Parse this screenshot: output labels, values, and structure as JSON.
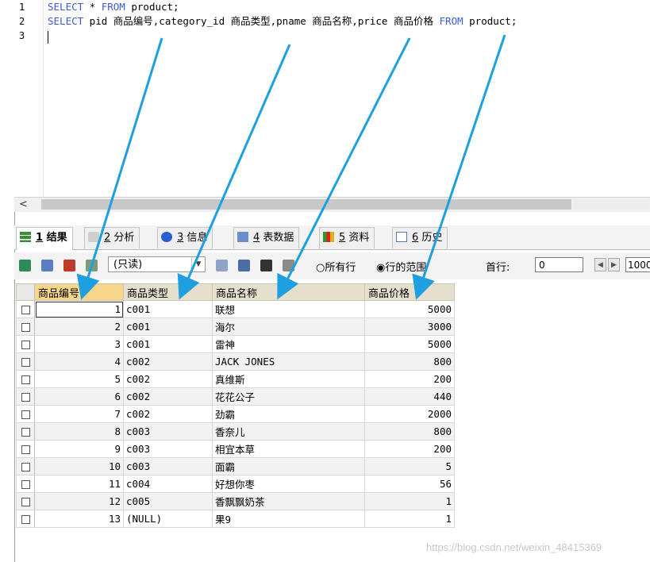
{
  "editor": {
    "line_numbers": [
      "1",
      "2",
      "3"
    ],
    "line1": {
      "kw1": "SELECT",
      "star": " * ",
      "kw2": "FROM",
      "rest": " product;"
    },
    "line2": {
      "kw1": "SELECT",
      "mid": " pid 商品编号,category_id 商品类型,pname 商品名称,price 商品价格 ",
      "kw2": "FROM",
      "rest": " product;"
    }
  },
  "hscroll": {
    "left_arrow": "<"
  },
  "tabs": [
    {
      "num": "1",
      "label": "结果"
    },
    {
      "num": "2",
      "label": "分析"
    },
    {
      "num": "3",
      "label": "信息"
    },
    {
      "num": "4",
      "label": "表数据"
    },
    {
      "num": "5",
      "label": "资料"
    },
    {
      "num": "6",
      "label": "历史"
    }
  ],
  "toolbar": {
    "mode_select": "(只读)",
    "radio_all": "所有行",
    "radio_range": "行的范围",
    "first_row_label": "首行:",
    "first_row_value": "0",
    "row_count_value": "1000"
  },
  "table": {
    "headers": [
      "商品编号",
      "商品类型",
      "商品名称",
      "商品价格"
    ],
    "rows": [
      [
        "1",
        "c001",
        "联想",
        "5000"
      ],
      [
        "2",
        "c001",
        "海尔",
        "3000"
      ],
      [
        "3",
        "c001",
        "雷神",
        "5000"
      ],
      [
        "4",
        "c002",
        "JACK JONES",
        "800"
      ],
      [
        "5",
        "c002",
        "真维斯",
        "200"
      ],
      [
        "6",
        "c002",
        "花花公子",
        "440"
      ],
      [
        "7",
        "c002",
        "劲霸",
        "2000"
      ],
      [
        "8",
        "c003",
        "香奈儿",
        "800"
      ],
      [
        "9",
        "c003",
        "相宜本草",
        "200"
      ],
      [
        "10",
        "c003",
        "面霸",
        "5"
      ],
      [
        "11",
        "c004",
        "好想你枣",
        "56"
      ],
      [
        "12",
        "c005",
        "香飘飘奶茶",
        "1"
      ],
      [
        "13",
        "(NULL)",
        "果9",
        "1"
      ]
    ]
  },
  "watermark": "https://blog.csdn.net/weixin_48415369",
  "colors": {
    "keyword": "#3b5bd8",
    "arrow": "#1ea0e0",
    "header_bg": "#e5dfcd",
    "active_header": "#f7d58a"
  }
}
